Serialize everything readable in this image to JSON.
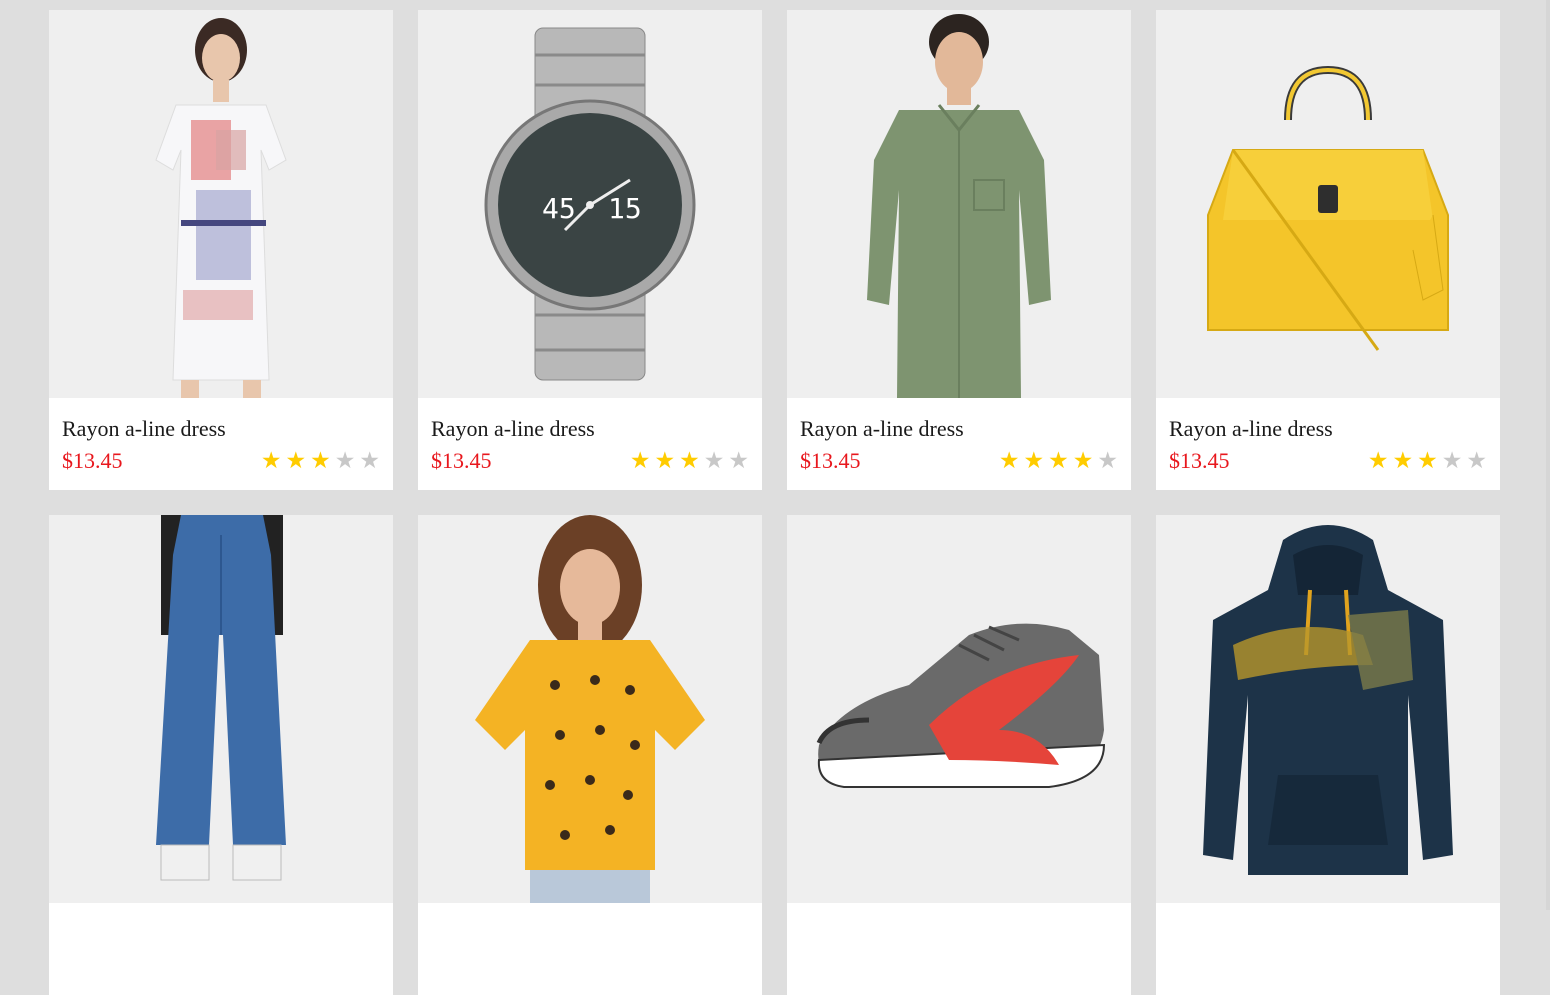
{
  "products": [
    {
      "name": "Rayon a-line dress",
      "price": "$13.45",
      "rating": 3,
      "max_rating": 5,
      "icon": "dress-image"
    },
    {
      "name": "Rayon a-line dress",
      "price": "$13.45",
      "rating": 3,
      "max_rating": 5,
      "icon": "watch-image"
    },
    {
      "name": "Rayon a-line dress",
      "price": "$13.45",
      "rating": 4,
      "max_rating": 5,
      "icon": "shirt-image"
    },
    {
      "name": "Rayon a-line dress",
      "price": "$13.45",
      "rating": 3,
      "max_rating": 5,
      "icon": "handbag-image"
    },
    {
      "name": "",
      "price": "",
      "rating": 0,
      "max_rating": 5,
      "icon": "jeans-image"
    },
    {
      "name": "",
      "price": "",
      "rating": 0,
      "max_rating": 5,
      "icon": "tshirt-image"
    },
    {
      "name": "",
      "price": "",
      "rating": 0,
      "max_rating": 5,
      "icon": "sneaker-image"
    },
    {
      "name": "",
      "price": "",
      "rating": 0,
      "max_rating": 5,
      "icon": "hoodie-image"
    }
  ],
  "colors": {
    "price": "#e8171d",
    "star_on": "#ffcc00",
    "star_off": "#c8c8c8",
    "page_bg": "#dedede",
    "thumb_bg": "#efefef"
  }
}
